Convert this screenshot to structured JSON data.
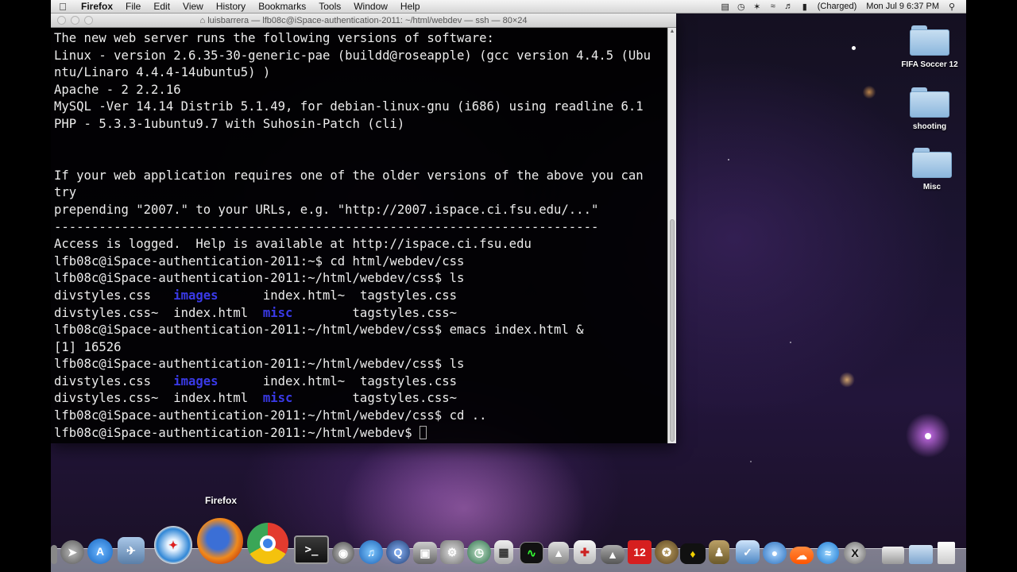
{
  "menubar": {
    "app_name": "Firefox",
    "items": [
      "File",
      "Edit",
      "View",
      "History",
      "Bookmarks",
      "Tools",
      "Window",
      "Help"
    ],
    "battery_status": "(Charged)",
    "clock": "Mon Jul 9   6:37 PM"
  },
  "terminal": {
    "title": "luisbarrera — lfb08c@iSpace-authentication-2011: ~/html/webdev — ssh — 80×24",
    "lines": [
      "The new web server runs the following versions of software:",
      "Linux - version 2.6.35-30-generic-pae (buildd@roseapple) (gcc version 4.4.5 (Ubu",
      "ntu/Linaro 4.4.4-14ubuntu5) )",
      "Apache - 2 2.2.16",
      "MySQL -Ver 14.14 Distrib 5.1.49, for debian-linux-gnu (i686) using readline 6.1",
      "PHP - 5.3.3-1ubuntu9.7 with Suhosin-Patch (cli)",
      "",
      "",
      "If your web application requires one of the older versions of the above you can",
      "try",
      "prepending \"2007.\" to your URLs, e.g. \"http://2007.ispace.ci.fsu.edu/...\"",
      "-------------------------------------------------------------------------",
      "Access is logged.  Help is available at http://ispace.ci.fsu.edu",
      "lfb08c@iSpace-authentication-2011:~$ cd html/webdev/css",
      "lfb08c@iSpace-authentication-2011:~/html/webdev/css$ ls",
      "",
      "",
      "lfb08c@iSpace-authentication-2011:~/html/webdev/css$ emacs index.html &",
      "[1] 16526",
      "lfb08c@iSpace-authentication-2011:~/html/webdev/css$ ls",
      "",
      "",
      "lfb08c@iSpace-authentication-2011:~/html/webdev/css$ cd ..",
      "lfb08c@iSpace-authentication-2011:~/html/webdev$ "
    ],
    "ls_rows": [
      [
        "divstyles.css   ",
        "images",
        "      index.html~  tagstyles.css"
      ],
      [
        "divstyles.css~  index.html  ",
        "misc",
        "        tagstyles.css~"
      ]
    ]
  },
  "desktop": {
    "icons": [
      {
        "label": "FIFA Soccer 12"
      },
      {
        "label": "shooting"
      },
      {
        "label": "Misc"
      }
    ]
  },
  "dock": {
    "tooltip": "Firefox",
    "badge_12": "12"
  }
}
